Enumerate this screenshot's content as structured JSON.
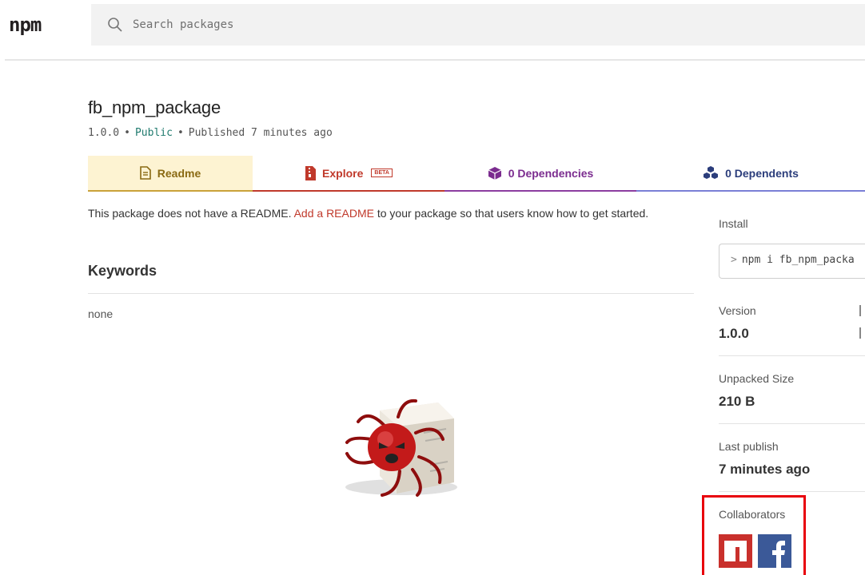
{
  "header": {
    "logo": "npm",
    "search_placeholder": "Search packages"
  },
  "package": {
    "name": "fb_npm_package",
    "version": "1.0.0",
    "visibility": "Public",
    "published": "Published 7 minutes ago"
  },
  "tabs": [
    {
      "label": "Readme",
      "icon": "document-icon"
    },
    {
      "label": "Explore",
      "icon": "zip-file-icon",
      "badge": "BETA"
    },
    {
      "label": "0 Dependencies",
      "icon": "box-icon"
    },
    {
      "label": "0 Dependents",
      "icon": "boxes-icon"
    }
  ],
  "readme": {
    "before": "This package does not have a README.",
    "link": "Add a README",
    "after": "to your package so that users know how to get started."
  },
  "keywords": {
    "heading": "Keywords",
    "value": "none"
  },
  "sidebar": {
    "install_label": "Install",
    "install_command": "npm i fb_npm_packa",
    "version_label": "Version",
    "version_value": "1.0.0",
    "size_label": "Unpacked Size",
    "size_value": "210 B",
    "last_publish_label": "Last publish",
    "last_publish_value": "7 minutes ago",
    "collaborators_label": "Collaborators"
  },
  "colors": {
    "npm_red": "#c0392b",
    "readme_tab_bg": "#fdf3d2",
    "highlight_red": "#e8000b",
    "facebook_blue": "#3b5998"
  }
}
